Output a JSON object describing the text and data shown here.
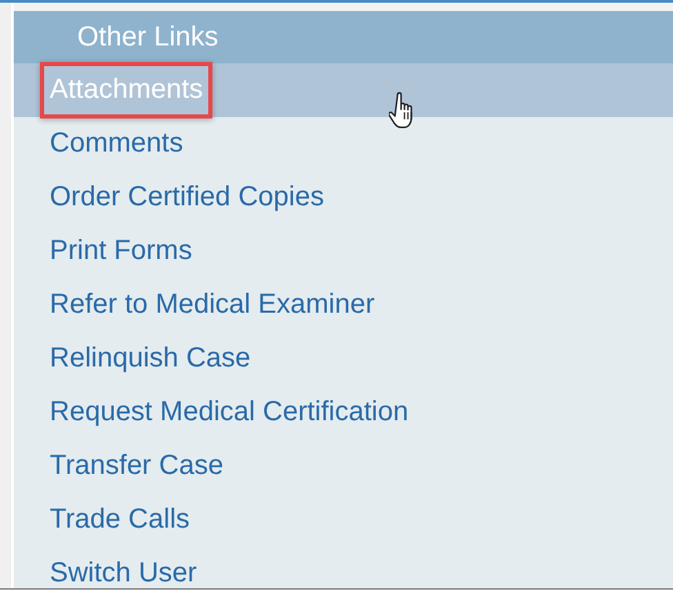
{
  "panel": {
    "title": "Other Links",
    "links": [
      {
        "label": "Attachments",
        "selected": true
      },
      {
        "label": "Comments",
        "selected": false
      },
      {
        "label": "Order Certified Copies",
        "selected": false
      },
      {
        "label": "Print Forms",
        "selected": false
      },
      {
        "label": "Refer to Medical Examiner",
        "selected": false
      },
      {
        "label": "Relinquish Case",
        "selected": false
      },
      {
        "label": "Request Medical Certification",
        "selected": false
      },
      {
        "label": "Transfer Case",
        "selected": false
      },
      {
        "label": "Trade Calls",
        "selected": false
      },
      {
        "label": "Switch User",
        "selected": false
      }
    ]
  }
}
